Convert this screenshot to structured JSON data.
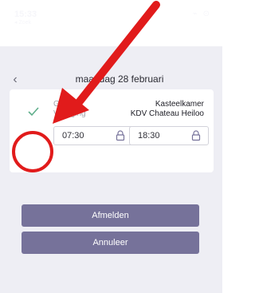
{
  "status_bar": {
    "time": "15:33",
    "back_label": "◂ Zoek",
    "icons": "⌁ ⊙"
  },
  "nav": {
    "title": "maandag 28 februari"
  },
  "card": {
    "labels": [
      "Groep",
      "Vestiging"
    ],
    "values": [
      "Kasteelkamer",
      "KDV Chateau Heiloo"
    ],
    "start_time": "07:30",
    "end_time": "18:30"
  },
  "buttons": {
    "unsubscribe": "Afmelden",
    "cancel": "Annuleer"
  },
  "colors": {
    "accent": "#76729a",
    "check": "#5fae8b",
    "annotation": "#e11b1b"
  }
}
